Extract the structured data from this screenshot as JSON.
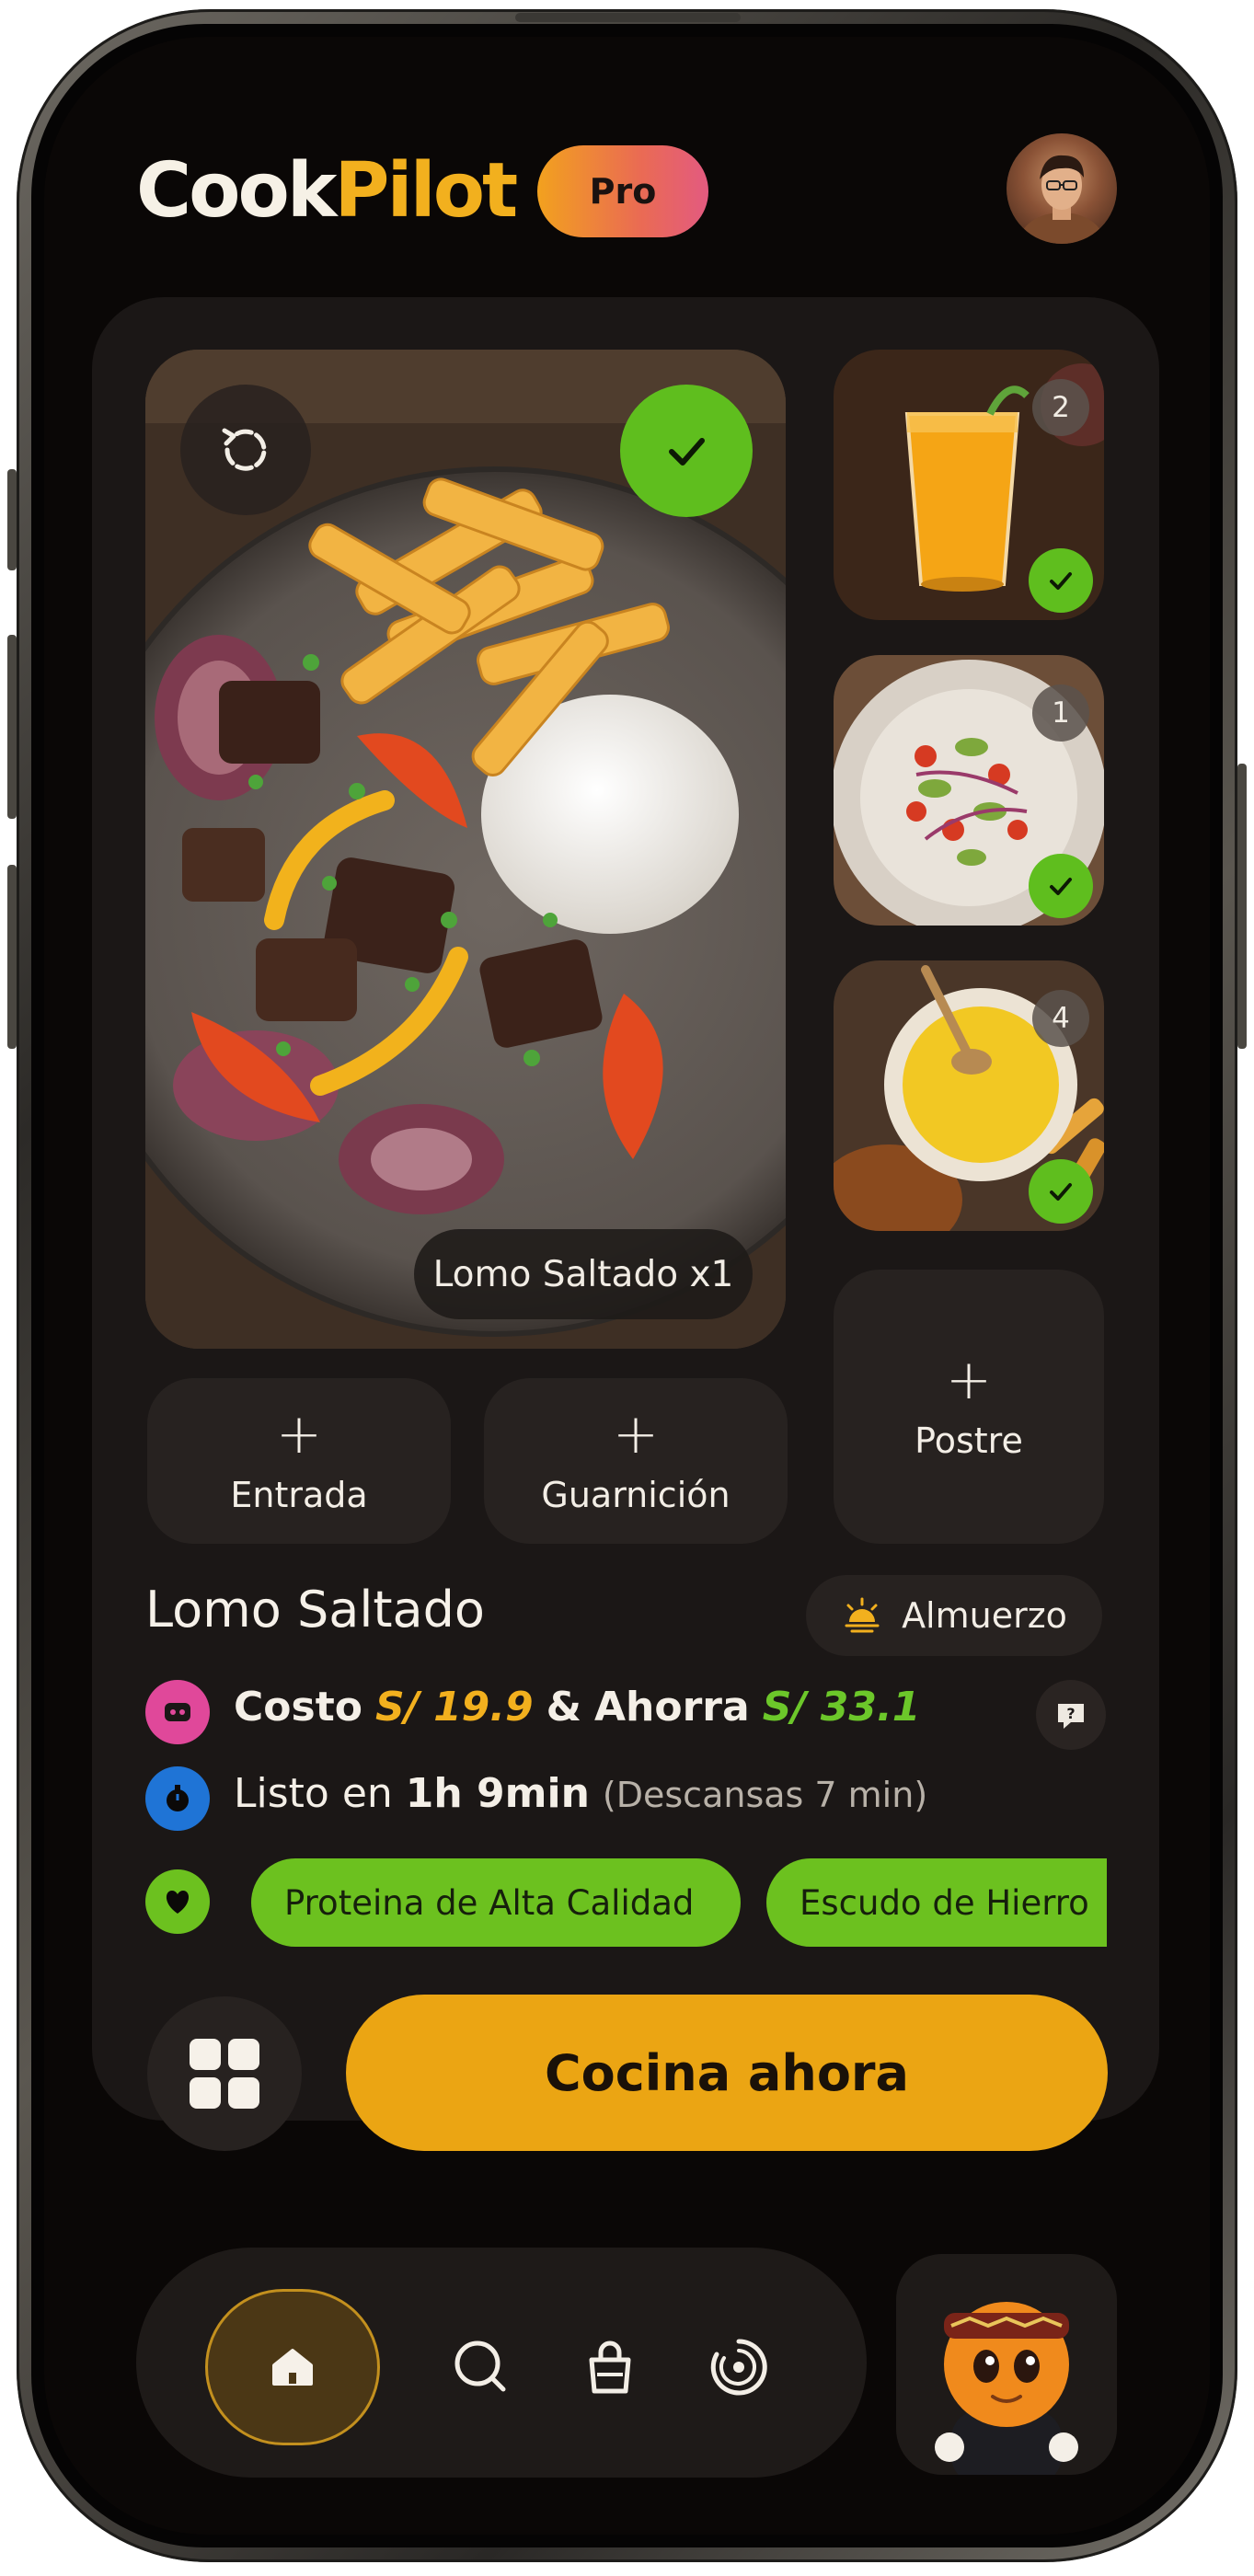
{
  "app": {
    "logo_part1": "Cook",
    "logo_part2": "Pilot",
    "badge": "Pro"
  },
  "main_dish": {
    "photo_label": "Lomo Saltado x1",
    "selected": true
  },
  "sides": [
    {
      "number": "2",
      "checked": true,
      "image": "orange-juice"
    },
    {
      "number": "1",
      "checked": true,
      "image": "salad"
    },
    {
      "number": "4",
      "checked": true,
      "image": "yellow-sauce"
    }
  ],
  "add_buttons": {
    "plus": "+",
    "entrada": "Entrada",
    "guarnicion": "Guarnición",
    "postre": "Postre"
  },
  "details": {
    "title": "Lomo Saltado",
    "meal_type": "Almuerzo",
    "cost_label": "Costo",
    "cost_value": "S/ 19.9",
    "amp": "&",
    "save_label": "Ahorra",
    "save_value": "S/ 33.1",
    "ready_prefix": "Listo en",
    "ready_time": "1h 9min",
    "rest_note": "(Descansas 7 min)",
    "tags": [
      "Proteina de Alta Calidad",
      "Escudo de Hierro"
    ]
  },
  "actions": {
    "cook_now": "Cocina ahora"
  },
  "nav": {
    "items": [
      "home-icon",
      "search-icon",
      "shopping-bag-icon",
      "progress-ring-icon"
    ],
    "active": "home-icon"
  },
  "colors": {
    "accent": "#eba513",
    "brand_orange": "#f2b01e",
    "green": "#6cc11f",
    "background": "#0a0706",
    "card": "#1b1716"
  }
}
